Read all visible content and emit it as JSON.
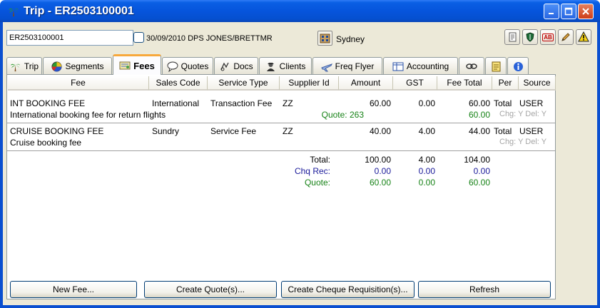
{
  "window": {
    "title": "Trip - ER2503100001"
  },
  "header": {
    "trip_id": "ER2503100001",
    "description": "30/09/2010 DPS JONES/BRETTMR",
    "location": "Sydney"
  },
  "header_icons": [
    "document-icon",
    "shield-icon",
    "spellcheck-icon",
    "pencil-icon",
    "warning-icon"
  ],
  "header_icon_labels": {
    "spellcheck": "AB"
  },
  "tabs": [
    {
      "label": "Trip",
      "icon": "palm-tree-icon"
    },
    {
      "label": "Segments",
      "icon": "segments-pie-icon"
    },
    {
      "label": "Fees",
      "icon": "fees-icon",
      "active": true
    },
    {
      "label": "Quotes",
      "icon": "speech-bubble-icon"
    },
    {
      "label": "Docs",
      "icon": "docs-icon"
    },
    {
      "label": "Clients",
      "icon": "clients-icon"
    },
    {
      "label": "Freq Flyer",
      "icon": "freq-flyer-icon"
    },
    {
      "label": "Accounting",
      "icon": "accounting-icon"
    }
  ],
  "columns": [
    "Fee",
    "Sales Code",
    "Service Type",
    "Supplier Id",
    "Amount",
    "GST",
    "Fee Total",
    "Per",
    "Source"
  ],
  "rows": [
    {
      "fee": "INT BOOKING FEE",
      "description": "International booking fee for return flights",
      "sales_code": "International",
      "service_type": "Transaction Fee",
      "supplier_id": "ZZ",
      "amount": "60.00",
      "gst": "0.00",
      "fee_total": "60.00",
      "per": "Total",
      "source": "USER",
      "quote_label": "Quote: 263",
      "quote_total": "60.00",
      "flags": "Chg: Y Del: Y"
    },
    {
      "fee": "CRUISE BOOKING FEE",
      "description": "Cruise booking fee",
      "sales_code": "Sundry",
      "service_type": "Service Fee",
      "supplier_id": "ZZ",
      "amount": "40.00",
      "gst": "4.00",
      "fee_total": "44.00",
      "per": "Total",
      "source": "USER",
      "flags": "Chg: Y Del: Y"
    }
  ],
  "totals": {
    "total": {
      "label": "Total:",
      "amount": "100.00",
      "gst": "4.00",
      "fee_total": "104.00"
    },
    "chq_rec": {
      "label": "Chq Rec:",
      "amount": "0.00",
      "gst": "0.00",
      "fee_total": "0.00"
    },
    "quote": {
      "label": "Quote:",
      "amount": "60.00",
      "gst": "0.00",
      "fee_total": "60.00"
    }
  },
  "buttons": {
    "new_fee": "New Fee...",
    "create_quote": "Create Quote(s)...",
    "create_cheque": "Create Cheque Requisition(s)...",
    "refresh": "Refresh"
  }
}
